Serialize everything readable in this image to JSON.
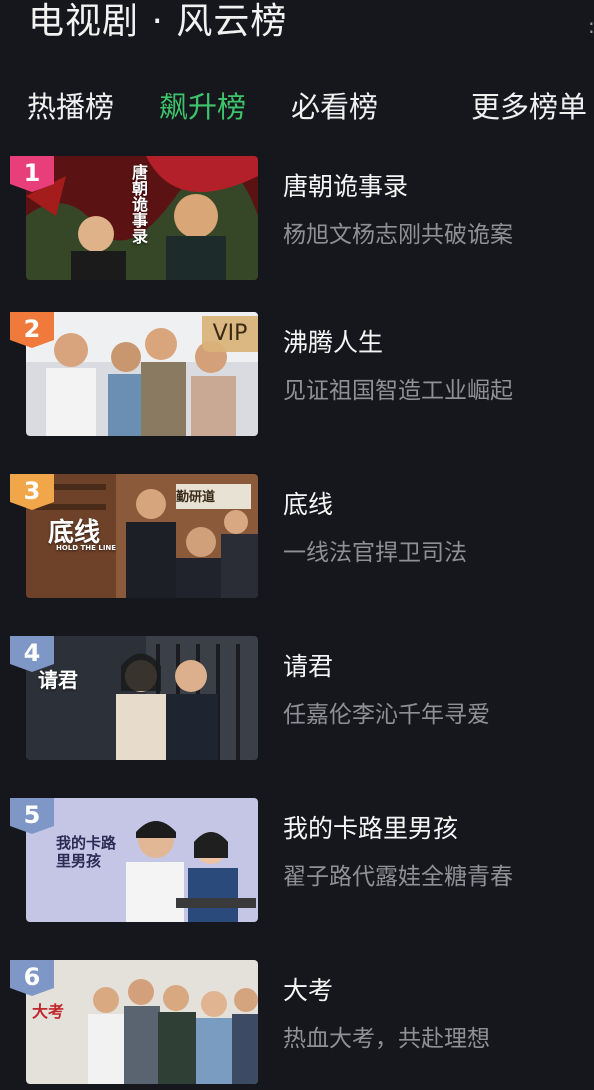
{
  "header": {
    "title": "电视剧 · 风云榜"
  },
  "tabs": [
    {
      "label": "热播榜",
      "active": false
    },
    {
      "label": "飙升榜",
      "active": true
    },
    {
      "label": "必看榜",
      "active": false
    },
    {
      "label": "更多榜单",
      "active": false
    }
  ],
  "colors": {
    "accent": "#3dc46b",
    "background": "#16171c",
    "rank_1": "#e83e7a",
    "rank_2": "#f07a3c",
    "rank_3": "#f2a64a",
    "rank_other": "#7f97c6",
    "vip_badge": "#d9b278"
  },
  "items": [
    {
      "rank": "1",
      "title": "唐朝诡事录",
      "desc": "杨旭文杨志刚共破诡案",
      "vip": ""
    },
    {
      "rank": "2",
      "title": "沸腾人生",
      "desc": "见证祖国智造工业崛起",
      "vip": "VIP"
    },
    {
      "rank": "3",
      "title": "底线",
      "desc": "一线法官捍卫司法",
      "vip": ""
    },
    {
      "rank": "4",
      "title": "请君",
      "desc": "任嘉伦李沁千年寻爱",
      "vip": ""
    },
    {
      "rank": "5",
      "title": "我的卡路里男孩",
      "desc": "翟子路代露娃全糖青春",
      "vip": ""
    },
    {
      "rank": "6",
      "title": "大考",
      "desc": "热血大考，共赴理想",
      "vip": ""
    }
  ],
  "posters": {
    "p1": "唐朝诡事录",
    "p3": "底线",
    "p3_sub": "HOLD THE LINE",
    "p3_plaque": "勤研道",
    "p4": "请君",
    "p5": "我的卡路里男孩",
    "p6": "大考"
  }
}
